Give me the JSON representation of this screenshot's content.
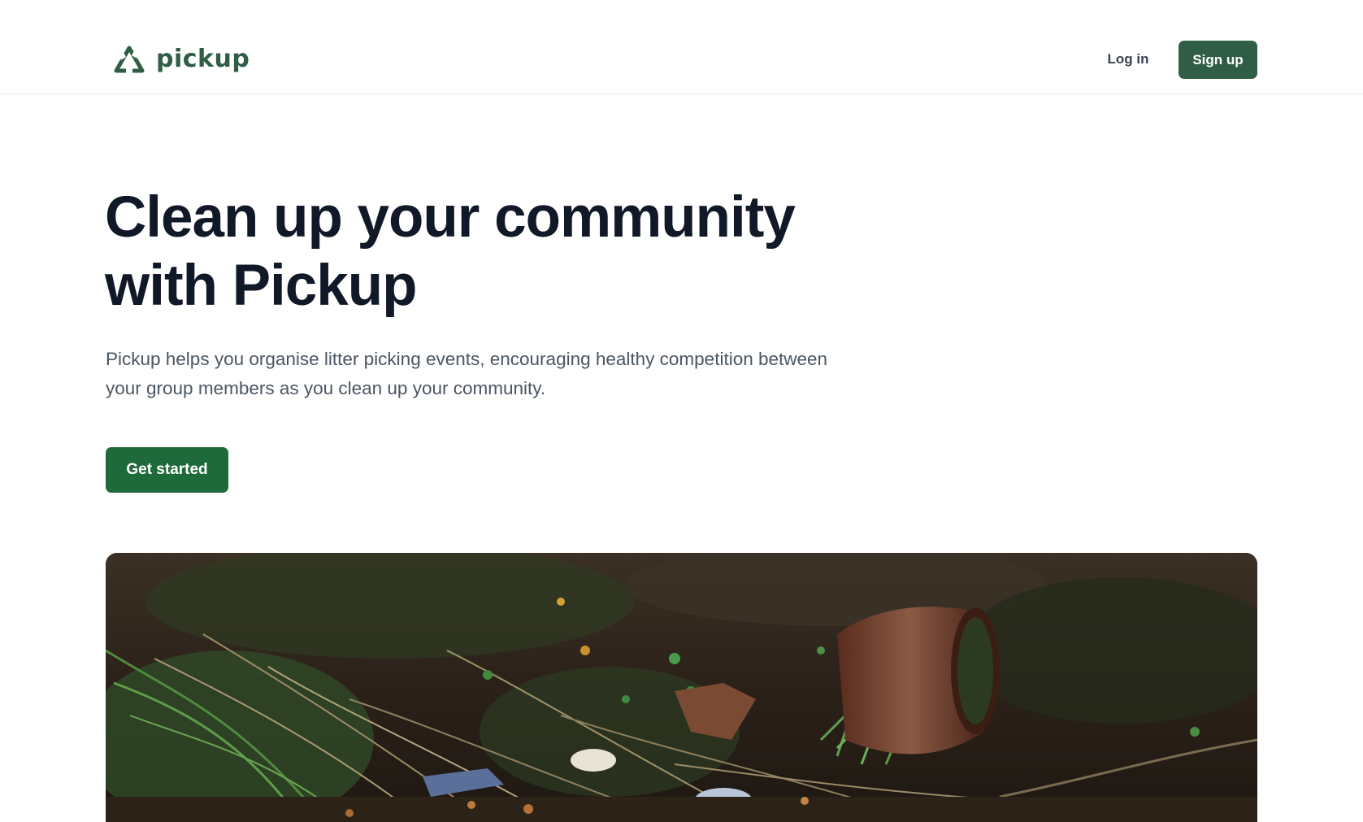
{
  "header": {
    "logo_text": "pickup",
    "login_label": "Log in",
    "signup_label": "Sign up"
  },
  "hero": {
    "title": "Clean up your community with Pickup",
    "subtitle": "Pickup helps you organise litter picking events, encouraging healthy competition between your group members as you clean up your community.",
    "cta_label": "Get started"
  },
  "theme": {
    "brand_green": "#2f5d45",
    "cta_green": "#1f6a3b",
    "text_dark": "#111827",
    "text_muted": "#4b5563"
  },
  "icons": {
    "logo": "recycle-triangle-icon"
  }
}
